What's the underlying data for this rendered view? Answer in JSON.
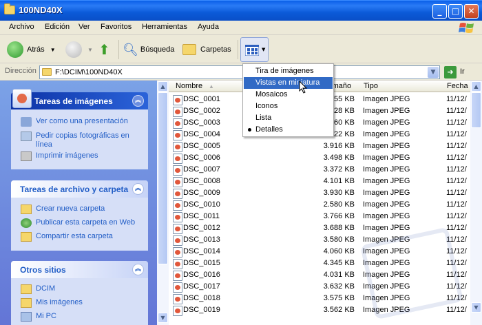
{
  "window": {
    "title": "100ND40X",
    "icon": "folder-icon"
  },
  "menubar": {
    "items": [
      "Archivo",
      "Edición",
      "Ver",
      "Favoritos",
      "Herramientas",
      "Ayuda"
    ]
  },
  "toolbar": {
    "back": "Atrás",
    "search": "Búsqueda",
    "folders": "Carpetas"
  },
  "address": {
    "label": "Dirección",
    "path": "F:\\DCIM\\100ND40X",
    "go": "Ir"
  },
  "left": {
    "image_tasks": {
      "title": "Tareas de imágenes",
      "items": [
        "Ver como una presentación",
        "Pedir copias fotográficas en línea",
        "Imprimir imágenes"
      ]
    },
    "file_tasks": {
      "title": "Tareas de archivo y carpeta",
      "items": [
        "Crear nueva carpeta",
        "Publicar esta carpeta en Web",
        "Compartir esta carpeta"
      ]
    },
    "other_places": {
      "title": "Otros sitios",
      "items": [
        "DCIM",
        "Mis imágenes",
        "Mi PC"
      ]
    }
  },
  "columns": {
    "name": "Nombre",
    "size": "Tamaño",
    "type": "Tipo",
    "date": "Fecha"
  },
  "files": [
    {
      "name": "DSC_0001",
      "size": "3.655 KB",
      "type": "Imagen JPEG",
      "date": "11/12/"
    },
    {
      "name": "DSC_0002",
      "size": "3.928 KB",
      "type": "Imagen JPEG",
      "date": "11/12/"
    },
    {
      "name": "DSC_0003",
      "size": "3.660 KB",
      "type": "Imagen JPEG",
      "date": "11/12/"
    },
    {
      "name": "DSC_0004",
      "size": "3.922 KB",
      "type": "Imagen JPEG",
      "date": "11/12/"
    },
    {
      "name": "DSC_0005",
      "size": "3.916 KB",
      "type": "Imagen JPEG",
      "date": "11/12/"
    },
    {
      "name": "DSC_0006",
      "size": "3.498 KB",
      "type": "Imagen JPEG",
      "date": "11/12/"
    },
    {
      "name": "DSC_0007",
      "size": "3.372 KB",
      "type": "Imagen JPEG",
      "date": "11/12/"
    },
    {
      "name": "DSC_0008",
      "size": "4.101 KB",
      "type": "Imagen JPEG",
      "date": "11/12/"
    },
    {
      "name": "DSC_0009",
      "size": "3.930 KB",
      "type": "Imagen JPEG",
      "date": "11/12/"
    },
    {
      "name": "DSC_0010",
      "size": "2.580 KB",
      "type": "Imagen JPEG",
      "date": "11/12/"
    },
    {
      "name": "DSC_0011",
      "size": "3.766 KB",
      "type": "Imagen JPEG",
      "date": "11/12/"
    },
    {
      "name": "DSC_0012",
      "size": "3.688 KB",
      "type": "Imagen JPEG",
      "date": "11/12/"
    },
    {
      "name": "DSC_0013",
      "size": "3.580 KB",
      "type": "Imagen JPEG",
      "date": "11/12/"
    },
    {
      "name": "DSC_0014",
      "size": "4.060 KB",
      "type": "Imagen JPEG",
      "date": "11/12/"
    },
    {
      "name": "DSC_0015",
      "size": "4.345 KB",
      "type": "Imagen JPEG",
      "date": "11/12/"
    },
    {
      "name": "DSC_0016",
      "size": "4.031 KB",
      "type": "Imagen JPEG",
      "date": "11/12/"
    },
    {
      "name": "DSC_0017",
      "size": "3.632 KB",
      "type": "Imagen JPEG",
      "date": "11/12/"
    },
    {
      "name": "DSC_0018",
      "size": "3.575 KB",
      "type": "Imagen JPEG",
      "date": "11/12/"
    },
    {
      "name": "DSC_0019",
      "size": "3.562 KB",
      "type": "Imagen JPEG",
      "date": "11/12/"
    }
  ],
  "view_menu": {
    "items": [
      "Tira de imágenes",
      "Vistas en miniatura",
      "Mosaicos",
      "Iconos",
      "Lista",
      "Detalles"
    ],
    "highlighted": "Vistas en miniatura",
    "selected": "Detalles"
  }
}
